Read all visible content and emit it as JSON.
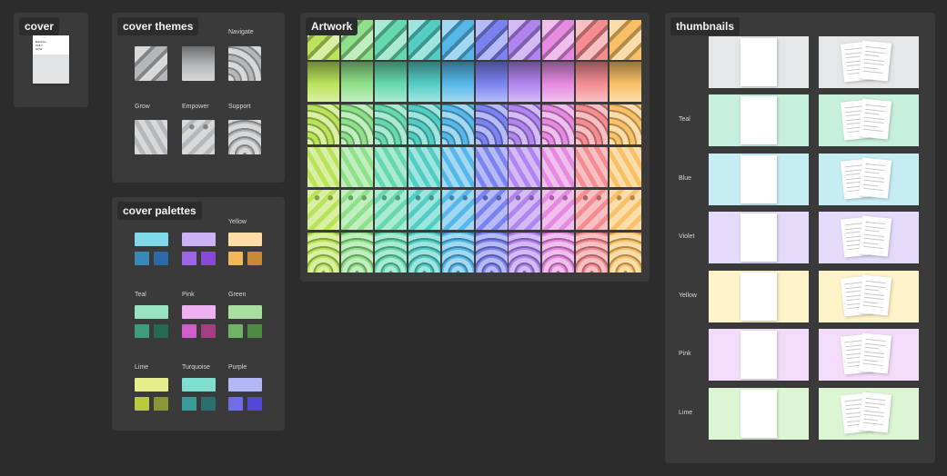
{
  "cover_frame": {
    "title": "cover",
    "doc_text": [
      "Build the",
      "ONLY",
      "HOW"
    ]
  },
  "themes_frame": {
    "title": "cover themes",
    "items": [
      {
        "label": "",
        "pattern": "stairs"
      },
      {
        "label": "",
        "pattern": "streaks"
      },
      {
        "label": "Navigate",
        "pattern": "curves"
      },
      {
        "label": "Grow",
        "pattern": "chevrons"
      },
      {
        "label": "Empower",
        "pattern": "dots"
      },
      {
        "label": "Support",
        "pattern": "arcs"
      }
    ]
  },
  "palettes_frame": {
    "title": "cover palettes",
    "items": [
      {
        "label": "",
        "top": "#7fd9e6",
        "b1": "#3a88b8",
        "b2": "#2b6aa6"
      },
      {
        "label": "",
        "top": "#cbb2f7",
        "b1": "#9b66e6",
        "b2": "#8a49d8"
      },
      {
        "label": "Yellow",
        "top": "#fbdda5",
        "b1": "#f0b85a",
        "b2": "#c98a36"
      },
      {
        "label": "Teal",
        "top": "#97e3c1",
        "b1": "#3e9d78",
        "b2": "#256b4f"
      },
      {
        "label": "Pink",
        "top": "#edb0f0",
        "b1": "#cf5ec8",
        "b2": "#a43e80"
      },
      {
        "label": "Green",
        "top": "#a8df9e",
        "b1": "#6fb464",
        "b2": "#4d8a42"
      },
      {
        "label": "Lime",
        "top": "#e5ee8a",
        "b1": "#b9c93f",
        "b2": "#8b9636"
      },
      {
        "label": "Turquoise",
        "top": "#7fded0",
        "b1": "#3a9c9b",
        "b2": "#2b6e6f"
      },
      {
        "label": "Purple",
        "top": "#b2b7f7",
        "b1": "#6e6ce6",
        "b2": "#5348d8"
      }
    ]
  },
  "artwork_frame": {
    "title": "Artwork",
    "columns": [
      "#b9e35a",
      "#8fe08a",
      "#65d8ad",
      "#53cdc4",
      "#55b8e8",
      "#7b83f0",
      "#b184ef",
      "#e58ae0",
      "#f48d92",
      "#f8c168"
    ],
    "rows": [
      "stairs",
      "streaks",
      "curves",
      "chevrons",
      "dots",
      "arcs"
    ]
  },
  "thumbnails_frame": {
    "title": "thumbnails",
    "rows": [
      {
        "label": "",
        "bg": "#e4e6e7"
      },
      {
        "label": "Teal",
        "bg": "#c6f0dc"
      },
      {
        "label": "Blue",
        "bg": "#c7edf4"
      },
      {
        "label": "Violet",
        "bg": "#e4dbfa"
      },
      {
        "label": "Yellow",
        "bg": "#fdf2c8"
      },
      {
        "label": "Pink",
        "bg": "#f3dcf9"
      },
      {
        "label": "Lime",
        "bg": "#dcf6d4"
      }
    ]
  }
}
